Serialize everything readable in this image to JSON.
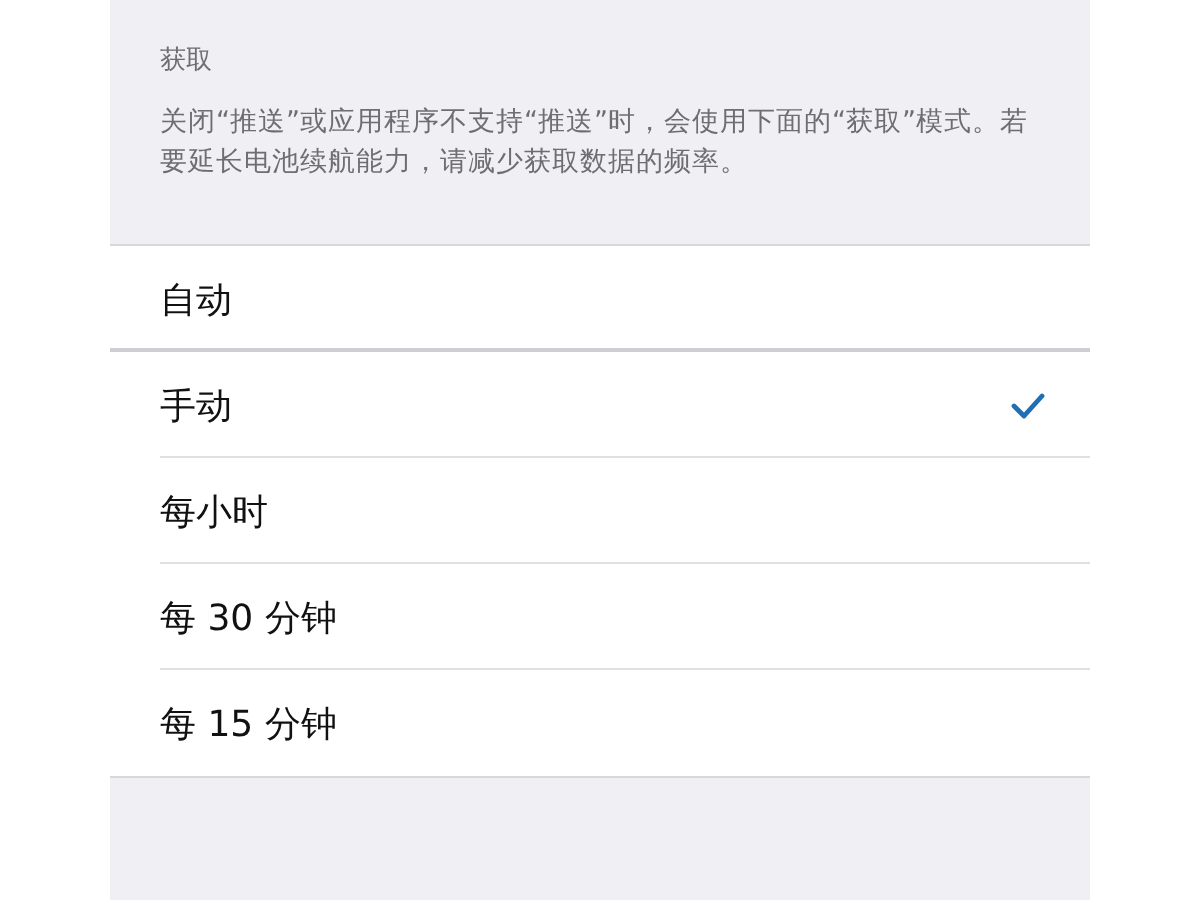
{
  "section": {
    "title": "获取",
    "description": "关闭“推送”或应用程序不支持“推送”时，会使用下面的“获取”模式。若要延长电池续航能力，请减少获取数据的频率。"
  },
  "options": [
    {
      "label": "自动",
      "selected": false
    },
    {
      "label": "手动",
      "selected": true
    },
    {
      "label": "每小时",
      "selected": false
    },
    {
      "label": "每 30 分钟",
      "selected": false
    },
    {
      "label": "每 15 分钟",
      "selected": false
    }
  ]
}
